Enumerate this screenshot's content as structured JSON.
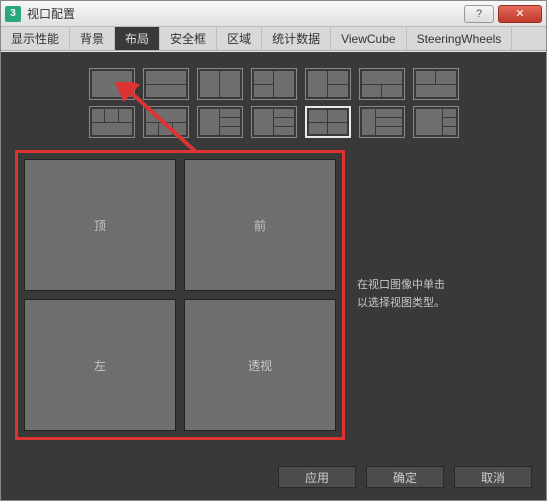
{
  "window": {
    "title": "视口配置"
  },
  "tabs": [
    "显示性能",
    "背景",
    "布局",
    "安全框",
    "区域",
    "统计数据",
    "ViewCube",
    "SteeringWheels"
  ],
  "active_tab_index": 2,
  "viewports": [
    "顶",
    "前",
    "左",
    "透视"
  ],
  "hint": {
    "line1": "在视口图像中单击",
    "line2": "以选择视图类型。"
  },
  "buttons": {
    "apply": "应用",
    "ok": "确定",
    "cancel": "取消"
  },
  "selected_layout_index": 11
}
